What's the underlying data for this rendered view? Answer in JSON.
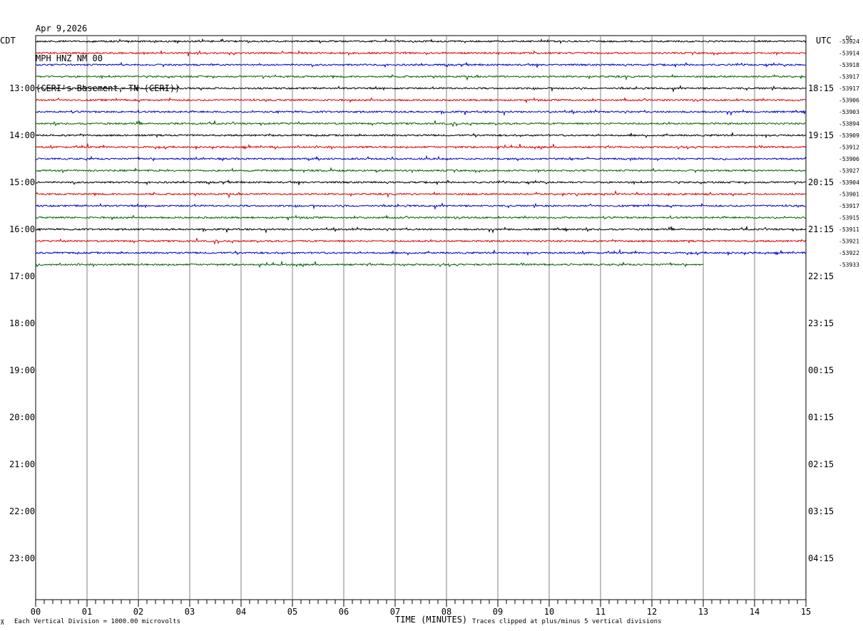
{
  "header": {
    "date": "Apr 9,2026",
    "station": "MPH HNZ NM 00",
    "location": "(CERI's Basement, TN (CERI))"
  },
  "left_tz": "CDT",
  "right_tz": "UTC",
  "dc_label": "DC",
  "footer": {
    "scale_note": "Each Vertical Division = 1000.00 microvolts",
    "clip_note": "Traces clipped at plus/minus 5 vertical divisions",
    "xlabel": "TIME (MINUTES)"
  },
  "colors": {
    "black": "#000000",
    "red": "#e00000",
    "blue": "#0000cc",
    "green": "#006400",
    "grid": "#808080"
  },
  "chart_data": {
    "type": "line",
    "xlabel": "TIME (MINUTES)",
    "xlim": [
      0,
      15
    ],
    "x_ticks": [
      "00",
      "01",
      "02",
      "03",
      "04",
      "05",
      "06",
      "07",
      "08",
      "09",
      "10",
      "11",
      "12",
      "13",
      "14",
      "15"
    ],
    "left_hour_labels": [
      "13:00",
      "14:00",
      "15:00",
      "16:00",
      "17:00",
      "18:00",
      "19:00",
      "20:00",
      "21:00",
      "22:00",
      "23:00"
    ],
    "right_hour_labels": [
      "18:15",
      "19:15",
      "20:15",
      "21:15",
      "22:15",
      "23:15",
      "00:15",
      "01:15",
      "02:15",
      "03:15",
      "04:15"
    ],
    "rows_per_hour": 4,
    "series_colors": [
      "black",
      "red",
      "blue",
      "green"
    ],
    "dc_offsets": [
      "-53924",
      "-53914",
      "-53918",
      "-53917",
      "-53917",
      "-53906",
      "-53903",
      "-53894",
      "-53909",
      "-53912",
      "-53906",
      "-53927",
      "-53904",
      "-53901",
      "-53917",
      "-53915",
      "-53911",
      "-53921",
      "-53922",
      "-53933"
    ],
    "last_trace_end_minute": 13.0
  }
}
